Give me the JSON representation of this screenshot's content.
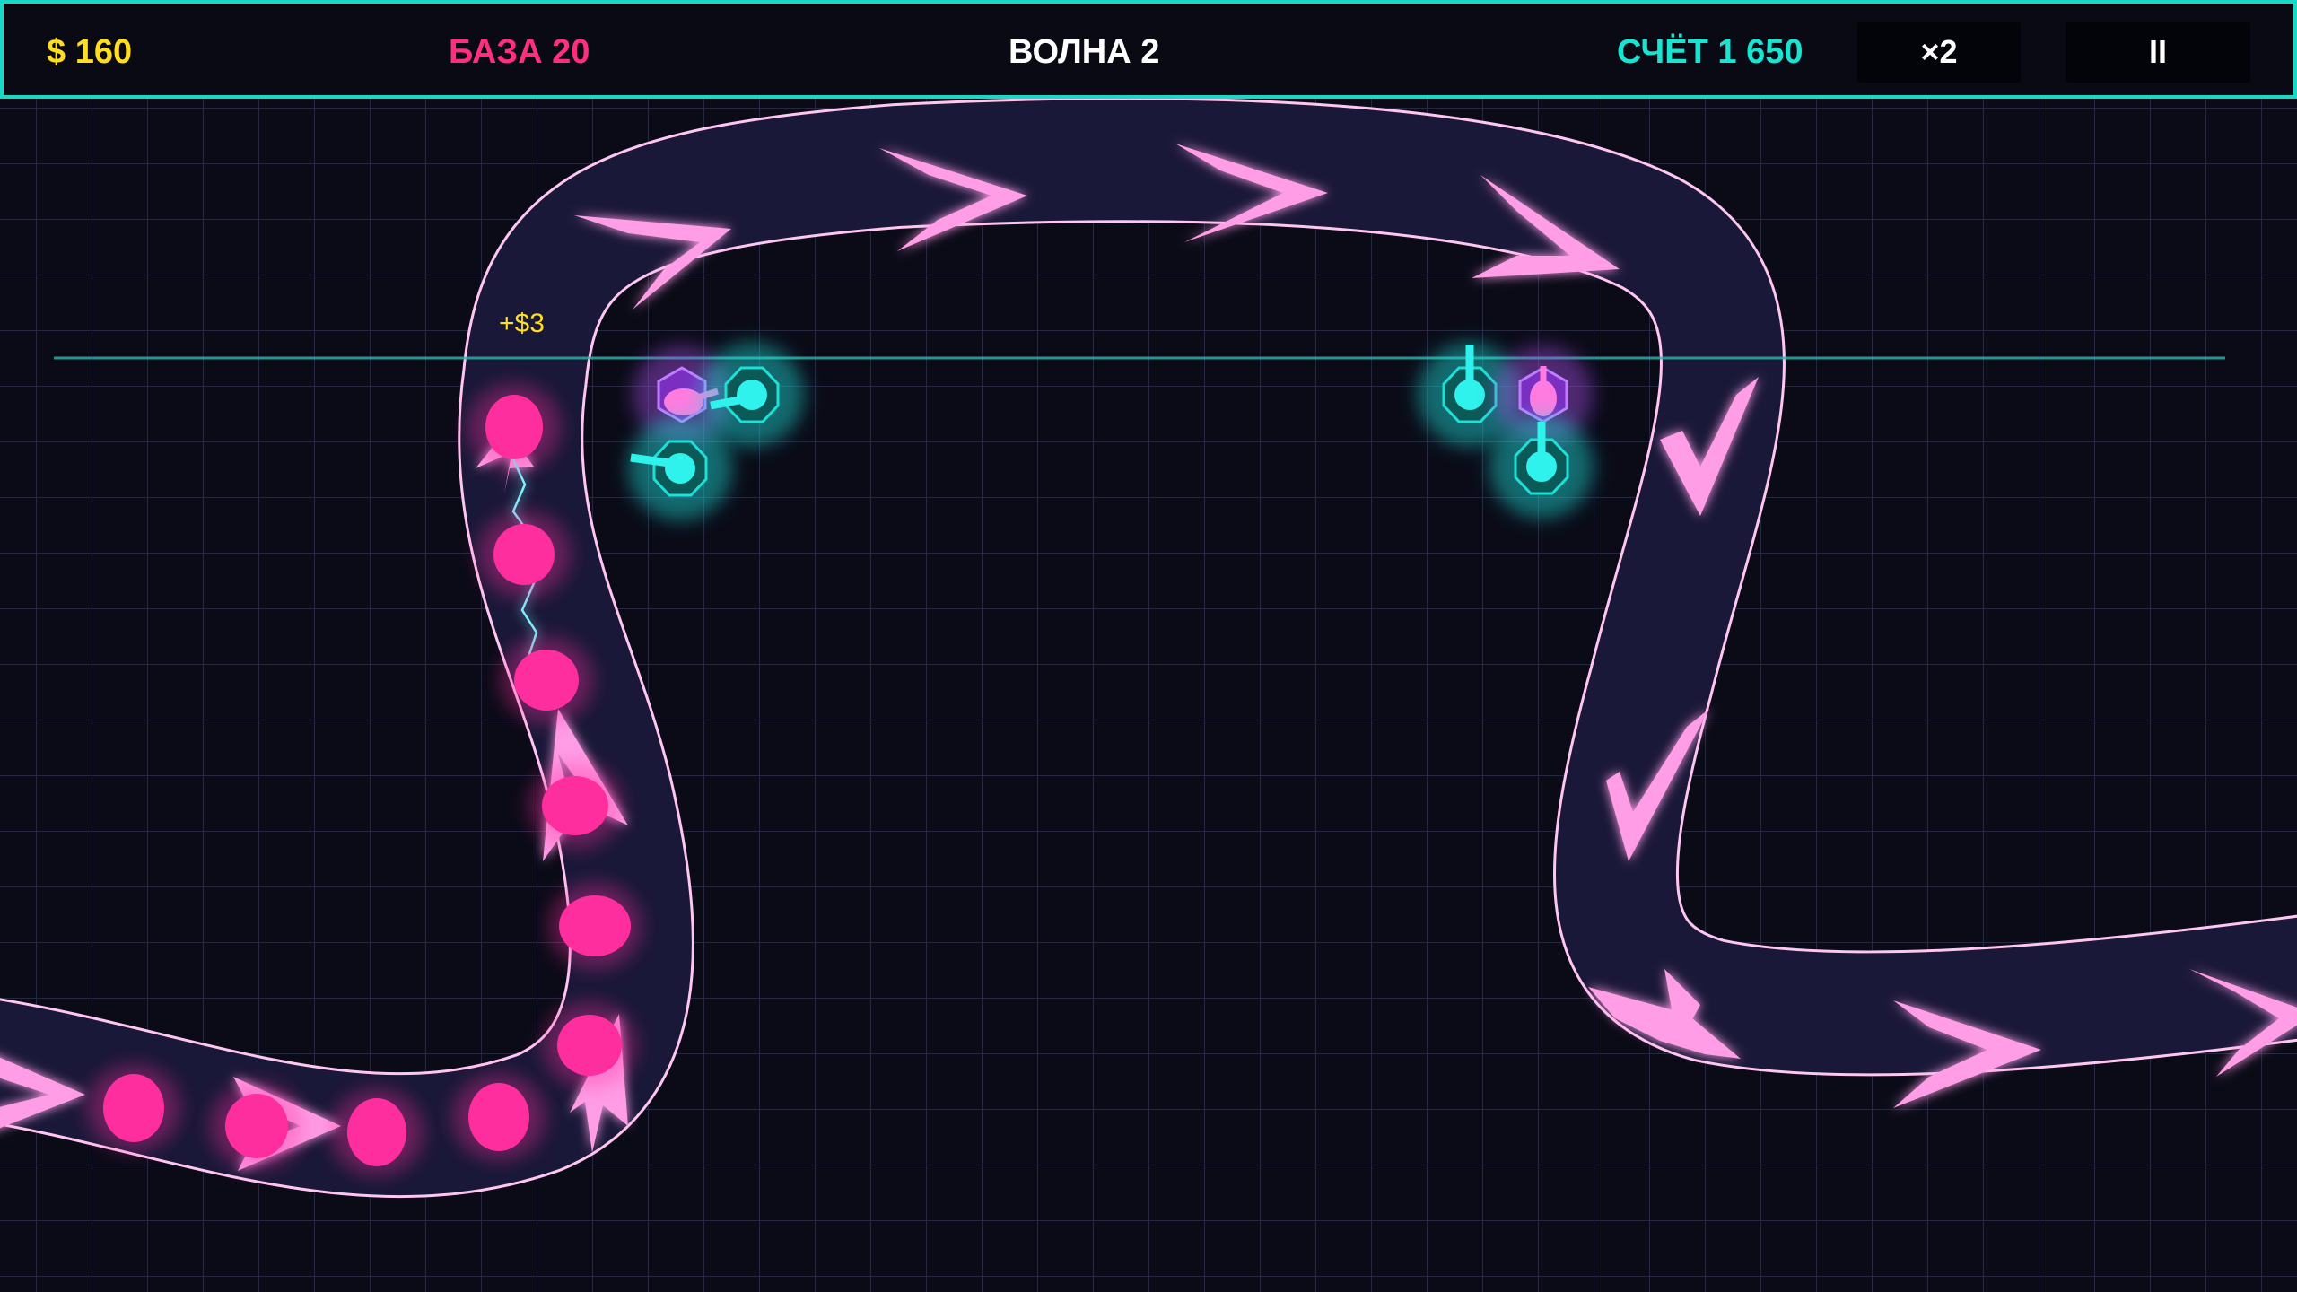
{
  "hud": {
    "money": "$ 160",
    "base": "БАЗА 20",
    "wave": "ВОЛНА 2",
    "score": "СЧЁТ 1 650",
    "speed_button": "×2",
    "pause_button": "II"
  },
  "floating_text": {
    "reward": "+$3"
  },
  "colors": {
    "background": "#0b0b18",
    "grid": "#262840",
    "hud_border": "#19d8c4",
    "path_fill": "#1a1838",
    "path_border": "#ffc6ef",
    "arrow": "#ff9de6",
    "enemy": "#ff2e9f",
    "tower": "#1de0d9",
    "tower_special": "#a14ee0",
    "money": "#ffdd1f",
    "base": "#ff2e7e",
    "score": "#19e3d1"
  },
  "towers": [
    {
      "kind": "laser",
      "icon": "octagon-turret-icon"
    },
    {
      "kind": "laser",
      "icon": "octagon-turret-icon"
    },
    {
      "kind": "laser",
      "icon": "octagon-turret-icon"
    },
    {
      "kind": "laser",
      "icon": "octagon-turret-icon"
    },
    {
      "kind": "special",
      "icon": "purple-hex-turret-icon"
    },
    {
      "kind": "special",
      "icon": "purple-hex-turret-icon"
    }
  ],
  "enemies_visible": 10
}
